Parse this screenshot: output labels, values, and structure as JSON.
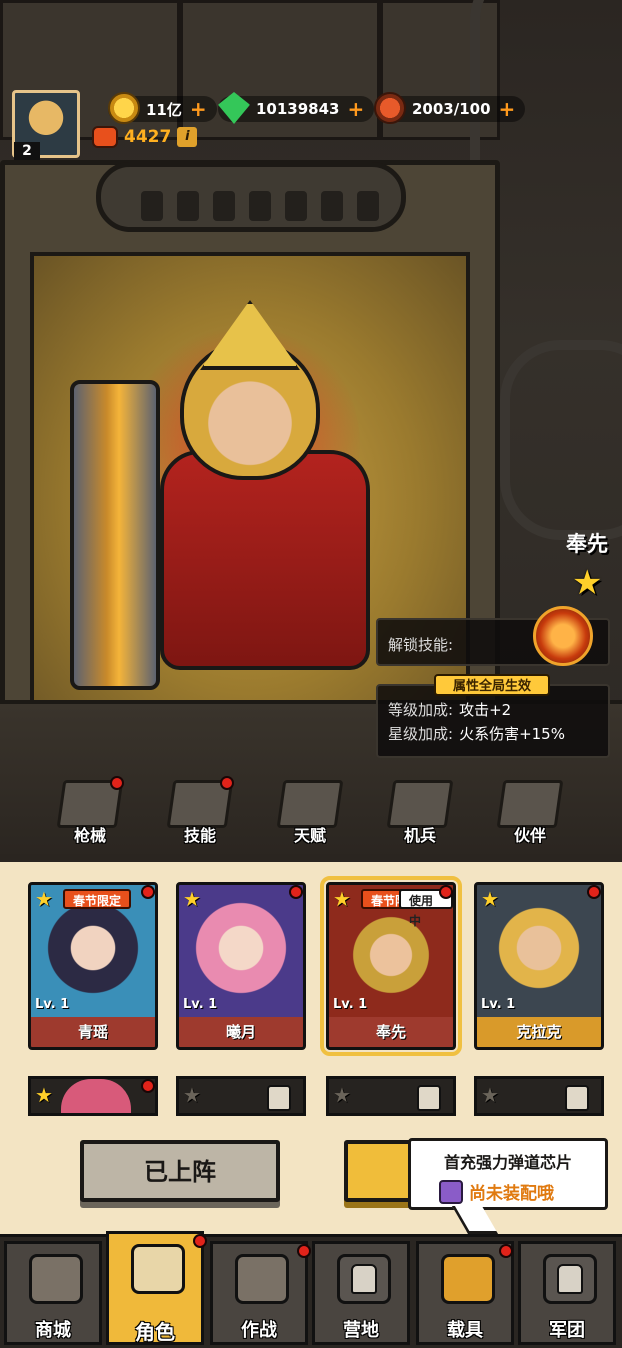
{
  "hud": {
    "player_level": "2",
    "gold": "11亿",
    "gems": "10139843",
    "stamina": "2003/100",
    "power": "4427",
    "plus_symbol": "+",
    "info_symbol": "i"
  },
  "hero": {
    "name": "奉先",
    "star_symbol": "★",
    "unlock_skill_label": "解锁技能:",
    "attr_tag": "属性全局生效",
    "level_bonus_label": "等级加成:",
    "level_bonus_value": "攻击+2",
    "star_bonus_label": "星级加成:",
    "star_bonus_value": "火系伤害+15%"
  },
  "function_tabs": [
    {
      "label": "枪械",
      "icon": "rifle-icon",
      "badge": true
    },
    {
      "label": "技能",
      "icon": "skill-arrows-icon",
      "badge": true
    },
    {
      "label": "天赋",
      "icon": "talent-nodes-icon",
      "badge": false
    },
    {
      "label": "机兵",
      "icon": "mech-icon",
      "badge": false
    },
    {
      "label": "伙伴",
      "icon": "partner-armor-icon",
      "badge": false
    }
  ],
  "roster": {
    "cards": [
      {
        "name": "青瑶",
        "level": "Lv. 1",
        "tag": "春节限定",
        "color": "#9e3a2e",
        "badge": true
      },
      {
        "name": "曦月",
        "level": "Lv. 1",
        "tag": "",
        "color": "#9e3a2e",
        "badge": true
      },
      {
        "name": "奉先",
        "level": "Lv. 1",
        "tag": "春节限定",
        "tag2": "使用中",
        "color": "#9e3a2e",
        "badge": true
      },
      {
        "name": "克拉克",
        "level": "Lv. 1",
        "tag": "",
        "color": "#d99a2a",
        "badge": true
      }
    ]
  },
  "buttons": {
    "deployed": "已上阵"
  },
  "bubble": {
    "line1": "首充强力弹道芯片",
    "line2": "尚未装配哦"
  },
  "nav": [
    {
      "label": "商城",
      "icon": "shop-cart-icon",
      "active": false,
      "locked": false
    },
    {
      "label": "角色",
      "icon": "character-helmet-icon",
      "active": true,
      "locked": false
    },
    {
      "label": "作战",
      "icon": "battle-guns-icon",
      "active": false,
      "locked": false
    },
    {
      "label": "营地",
      "icon": "lock-icon",
      "active": false,
      "locked": true
    },
    {
      "label": "载具",
      "icon": "vehicle-crane-icon",
      "active": false,
      "locked": false
    },
    {
      "label": "军团",
      "icon": "lock-icon",
      "active": false,
      "locked": true
    }
  ],
  "colors": {
    "accent": "#f0b93a",
    "badge_red": "#e2231a",
    "gold_text": "#ffb020",
    "orange_text": "#e07a10"
  }
}
